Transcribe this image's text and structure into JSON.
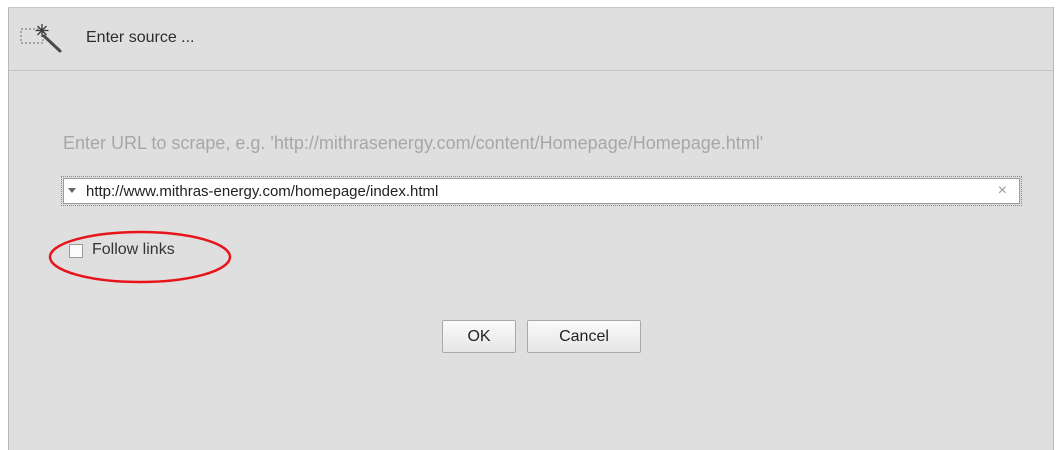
{
  "dialog": {
    "title": "Enter source ...",
    "title_icon": "magic-wand-selection-icon",
    "hint": "Enter URL to scrape, e.g. 'http://mithrasenergy.com/content/Homepage/Homepage.html'",
    "url_value": "http://www.mithras-energy.com/homepage/index.html",
    "clear_symbol": "×",
    "follow_links_label": "Follow links",
    "follow_links_checked": false,
    "ok_label": "OK",
    "cancel_label": "Cancel"
  },
  "colors": {
    "dialog_background": "#dfdfdf",
    "annotation": "#e8141b",
    "hint_text": "#a7a7a7"
  }
}
